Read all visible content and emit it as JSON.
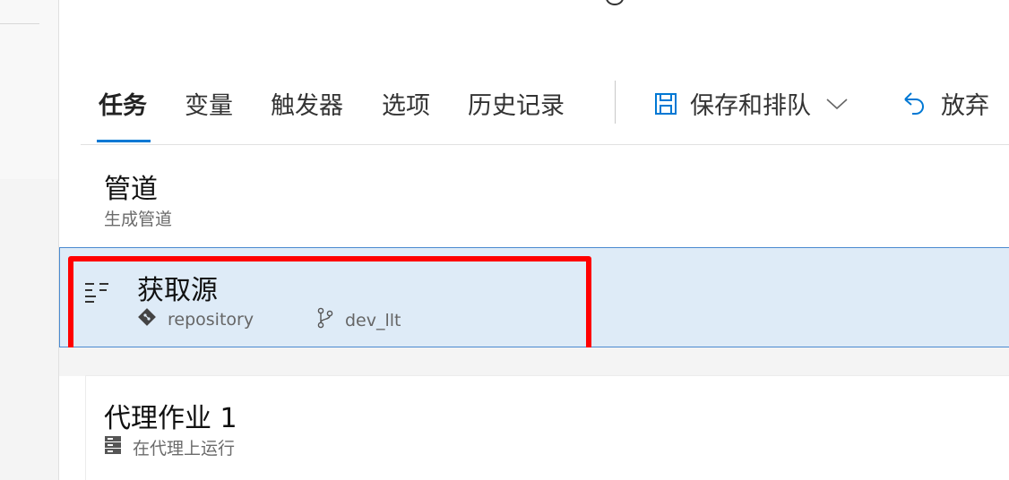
{
  "tabs": [
    {
      "label": "任务",
      "active": true
    },
    {
      "label": "变量",
      "active": false
    },
    {
      "label": "触发器",
      "active": false
    },
    {
      "label": "选项",
      "active": false
    },
    {
      "label": "历史记录",
      "active": false
    }
  ],
  "toolbar": {
    "save_queue_label": "保存和排队",
    "discard_label": "放弃"
  },
  "pipeline": {
    "title": "管道",
    "subtitle": "生成管道"
  },
  "get_sources": {
    "title": "获取源",
    "repository": "repository",
    "branch": "dev_llt"
  },
  "agent_job": {
    "title": "代理作业 1",
    "subtitle": "在代理上运行"
  },
  "colors": {
    "accent": "#0078d4",
    "selected_row": "#deebf7",
    "highlight": "#ff0000"
  }
}
